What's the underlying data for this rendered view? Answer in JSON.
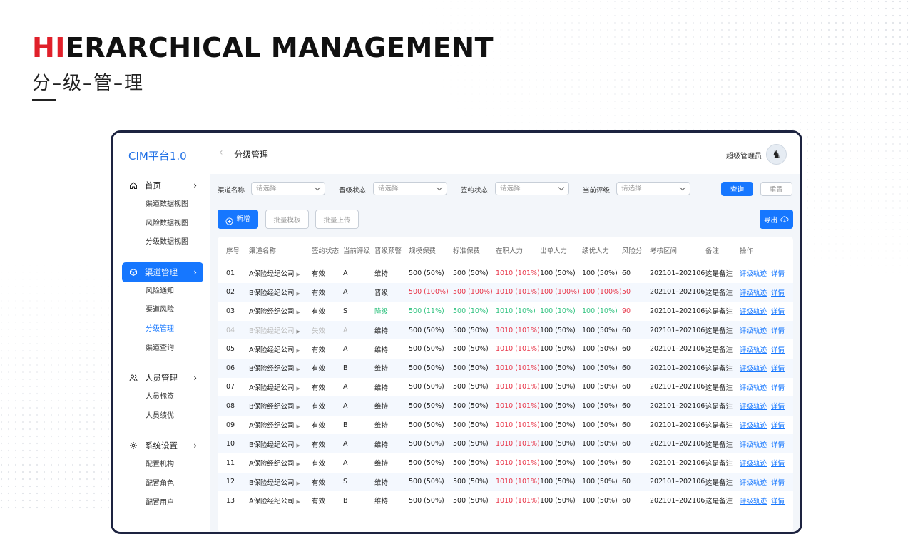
{
  "hero": {
    "title_red": "HI",
    "title_rest": "ERARCHICAL MANAGEMENT",
    "subtitle": "分–级–管–理"
  },
  "app": {
    "brand": "CIM平台1.0",
    "page_title": "分级管理",
    "user_name": "超级管理员"
  },
  "sidebar": {
    "groups": [
      {
        "label": "首页",
        "icon": "home-icon",
        "active": false,
        "items": [
          "渠道数据视图",
          "风险数据视图",
          "分级数据视图"
        ]
      },
      {
        "label": "渠道管理",
        "icon": "cube-icon",
        "active": true,
        "items": [
          "风险通知",
          "渠道风险",
          "分级管理",
          "渠道查询"
        ]
      },
      {
        "label": "人员管理",
        "icon": "users-icon",
        "active": false,
        "items": [
          "人员标签",
          "人员绩优"
        ]
      },
      {
        "label": "系统设置",
        "icon": "gear-icon",
        "active": false,
        "items": [
          "配置机构",
          "配置角色",
          "配置用户"
        ]
      }
    ],
    "current_item": "分级管理"
  },
  "filters": [
    {
      "label": "渠道名称",
      "placeholder": "请选择"
    },
    {
      "label": "晋级状态",
      "placeholder": "请选择"
    },
    {
      "label": "签约状态",
      "placeholder": "请选择"
    },
    {
      "label": "当前评级",
      "placeholder": "请选择"
    }
  ],
  "buttons": {
    "query": "查询",
    "reset": "重置",
    "add": "新增",
    "batch_template": "批量模板",
    "batch_upload": "批量上传",
    "export": "导出"
  },
  "table": {
    "columns": [
      "序号",
      "渠道名称",
      "签约状态",
      "当前评级",
      "晋级预警",
      "规模保费",
      "标准保费",
      "在职人力",
      "出单人力",
      "绩优人力",
      "风险分",
      "考核区间",
      "备注",
      "操作"
    ],
    "actions": [
      "评级轨迹",
      "详情"
    ],
    "rows": [
      {
        "no": "01",
        "name": "A保险经纪公司",
        "sign": "有效",
        "rating": "A",
        "warn": "维持",
        "scale": "500 (50%)",
        "std": "500 (50%)",
        "staff": "1010 (101%)",
        "issue": "100 (50%)",
        "excel": "100 (50%)",
        "risk": "60",
        "period": "202101–202106",
        "note": "这是备注",
        "state": "normal",
        "staff_red": true
      },
      {
        "no": "02",
        "name": "B保险经纪公司",
        "sign": "有效",
        "rating": "A",
        "warn": "晋级",
        "scale": "500 (100%)",
        "std": "500 (100%)",
        "staff": "1010 (101%)",
        "issue": "100 (100%)",
        "excel": "100 (100%)",
        "risk": "50",
        "period": "202101–202106",
        "note": "这是备注",
        "state": "up"
      },
      {
        "no": "03",
        "name": "A保险经纪公司",
        "sign": "有效",
        "rating": "S",
        "warn": "降级",
        "scale": "500 (11%)",
        "std": "500 (10%)",
        "staff": "1010 (10%)",
        "issue": "100 (10%)",
        "excel": "100 (10%)",
        "risk": "90",
        "period": "202101–202106",
        "note": "这是备注",
        "state": "down"
      },
      {
        "no": "04",
        "name": "B保险经纪公司",
        "sign": "失效",
        "rating": "A",
        "warn": "维持",
        "scale": "500 (50%)",
        "std": "500 (50%)",
        "staff": "1010 (101%)",
        "issue": "100 (50%)",
        "excel": "100 (50%)",
        "risk": "60",
        "period": "202101–202106",
        "note": "这是备注",
        "state": "invalid"
      },
      {
        "no": "05",
        "name": "A保险经纪公司",
        "sign": "有效",
        "rating": "A",
        "warn": "维持",
        "scale": "500 (50%)",
        "std": "500 (50%)",
        "staff": "1010 (101%)",
        "issue": "100 (50%)",
        "excel": "100 (50%)",
        "risk": "60",
        "period": "202101–202106",
        "note": "这是备注",
        "state": "normal"
      },
      {
        "no": "06",
        "name": "B保险经纪公司",
        "sign": "有效",
        "rating": "B",
        "warn": "维持",
        "scale": "500 (50%)",
        "std": "500 (50%)",
        "staff": "1010 (101%)",
        "issue": "100 (50%)",
        "excel": "100 (50%)",
        "risk": "60",
        "period": "202101–202106",
        "note": "这是备注",
        "state": "normal"
      },
      {
        "no": "07",
        "name": "A保险经纪公司",
        "sign": "有效",
        "rating": "A",
        "warn": "维持",
        "scale": "500 (50%)",
        "std": "500 (50%)",
        "staff": "1010 (101%)",
        "issue": "100 (50%)",
        "excel": "100 (50%)",
        "risk": "60",
        "period": "202101–202106",
        "note": "这是备注",
        "state": "normal"
      },
      {
        "no": "08",
        "name": "B保险经纪公司",
        "sign": "有效",
        "rating": "A",
        "warn": "维持",
        "scale": "500 (50%)",
        "std": "500 (50%)",
        "staff": "1010 (101%)",
        "issue": "100 (50%)",
        "excel": "100 (50%)",
        "risk": "60",
        "period": "202101–202106",
        "note": "这是备注",
        "state": "normal"
      },
      {
        "no": "09",
        "name": "A保险经纪公司",
        "sign": "有效",
        "rating": "B",
        "warn": "维持",
        "scale": "500 (50%)",
        "std": "500 (50%)",
        "staff": "1010 (101%)",
        "issue": "100 (50%)",
        "excel": "100 (50%)",
        "risk": "60",
        "period": "202101–202106",
        "note": "这是备注",
        "state": "normal"
      },
      {
        "no": "10",
        "name": "B保险经纪公司",
        "sign": "有效",
        "rating": "A",
        "warn": "维持",
        "scale": "500 (50%)",
        "std": "500 (50%)",
        "staff": "1010 (101%)",
        "issue": "100 (50%)",
        "excel": "100 (50%)",
        "risk": "60",
        "period": "202101–202106",
        "note": "这是备注",
        "state": "normal"
      },
      {
        "no": "11",
        "name": "A保险经纪公司",
        "sign": "有效",
        "rating": "A",
        "warn": "维持",
        "scale": "500 (50%)",
        "std": "500 (50%)",
        "staff": "1010 (101%)",
        "issue": "100 (50%)",
        "excel": "100 (50%)",
        "risk": "60",
        "period": "202101–202106",
        "note": "这是备注",
        "state": "normal"
      },
      {
        "no": "12",
        "name": "B保险经纪公司",
        "sign": "有效",
        "rating": "S",
        "warn": "维持",
        "scale": "500 (50%)",
        "std": "500 (50%)",
        "staff": "1010 (101%)",
        "issue": "100 (50%)",
        "excel": "100 (50%)",
        "risk": "60",
        "period": "202101–202106",
        "note": "这是备注",
        "state": "normal"
      },
      {
        "no": "13",
        "name": "A保险经纪公司",
        "sign": "有效",
        "rating": "B",
        "warn": "维持",
        "scale": "500 (50%)",
        "std": "500 (50%)",
        "staff": "1010 (101%)",
        "issue": "100 (50%)",
        "excel": "100 (50%)",
        "risk": "60",
        "period": "202101–202106",
        "note": "这是备注",
        "state": "normal"
      }
    ]
  },
  "colors": {
    "accent": "#1677ff",
    "danger": "#e8374a",
    "success": "#2ec27e",
    "hero_red": "#e0202a",
    "frame": "#1d2340"
  }
}
